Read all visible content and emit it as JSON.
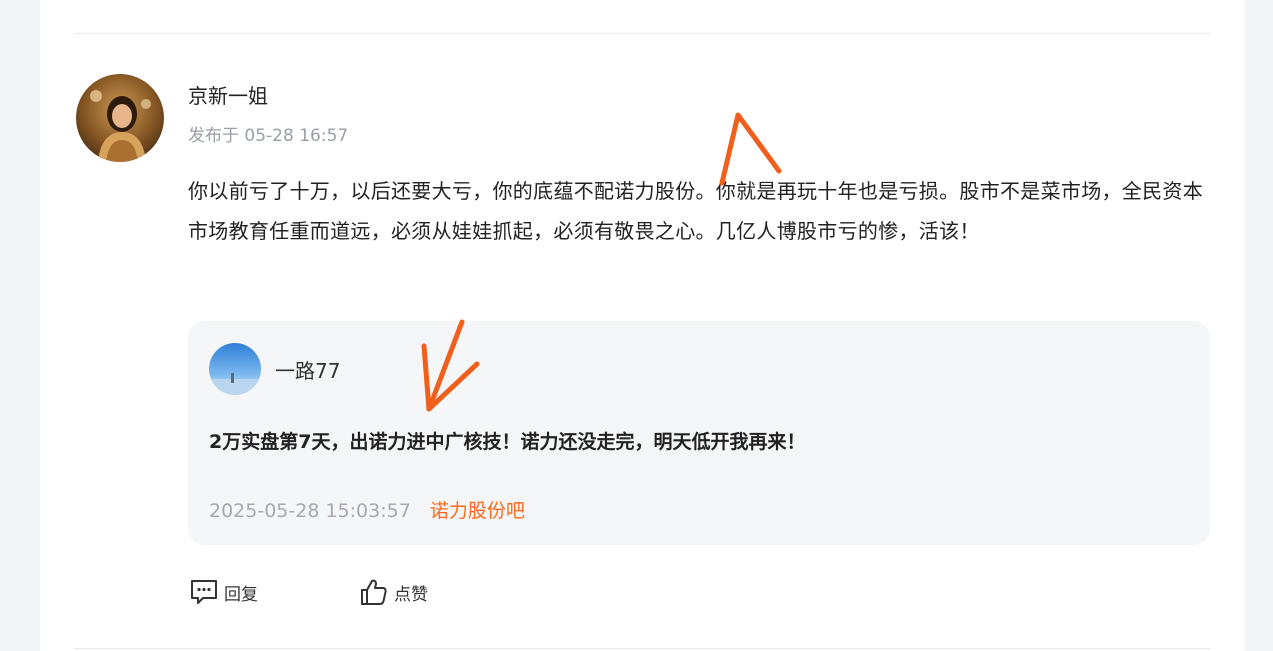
{
  "comment": {
    "author": "京新一姐",
    "time": "发布于 05-28 16:57",
    "body": "你以前亏了十万，以后还要大亏，你的底蕴不配诺力股份。你就是再玩十年也是亏损。股市不是菜市场，全民资本市场教育任重而道远，必须从娃娃抓起，必须有敬畏之心。几亿人博股市亏的惨，活该！"
  },
  "quote": {
    "author": "一路77",
    "text": "2万实盘第7天，出诺力进中广核技！诺力还没走完，明天低开我再来！",
    "date": "2025-05-28 15:03:57",
    "forum_link": "诺力股份吧"
  },
  "actions": {
    "reply_label": "回复",
    "like_label": "点赞"
  },
  "colors": {
    "accent": "#ff6a1a",
    "annotation_arrow": "#f0601c",
    "muted_text": "#9aa0a8",
    "card_background": "#f5f6f8"
  },
  "icons": {
    "reply": "comment-icon",
    "like": "thumbs-up-icon"
  }
}
